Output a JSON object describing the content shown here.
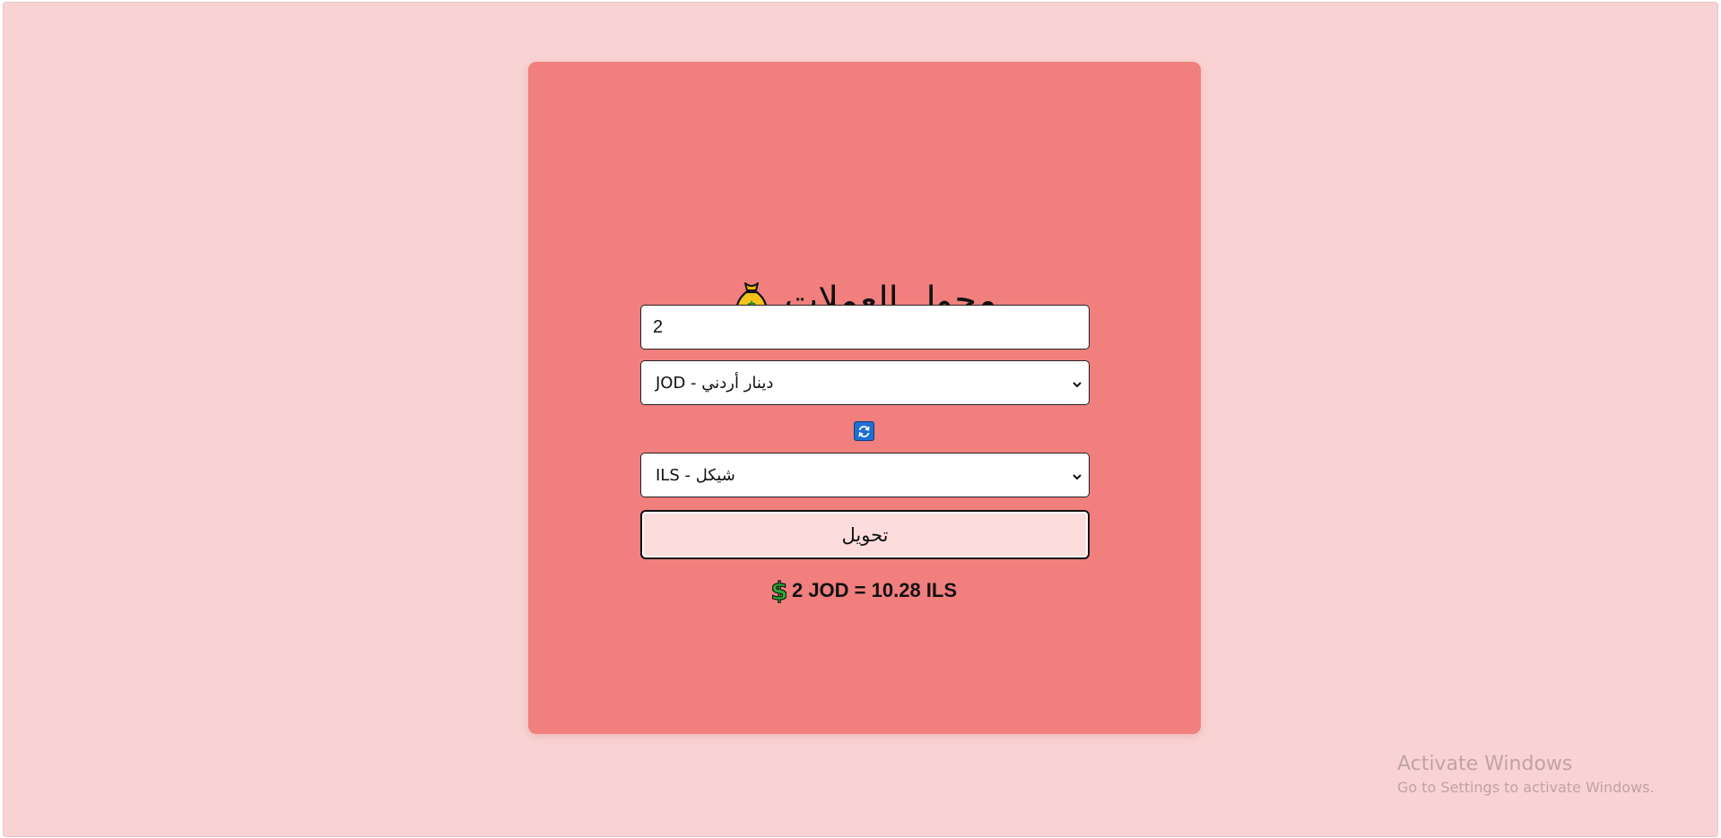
{
  "converter": {
    "title": "محول العملات",
    "title_icon": "money-bag-icon",
    "amount": {
      "value": "2",
      "placeholder": ""
    },
    "from_currency": {
      "selected": "JOD - دينار أردني",
      "code": "JOD"
    },
    "swap_icon": "swap-arrows-icon",
    "to_currency": {
      "selected": "ILS - شيكل",
      "code": "ILS"
    },
    "convert_label": "تحويل",
    "result": {
      "icon": "dollar-icon",
      "text": "2 JOD = 10.28 ILS"
    }
  },
  "watermark": {
    "title": "Activate Windows",
    "subtitle": "Go to Settings to activate Windows."
  },
  "colors": {
    "page_background": "#f9d3d3",
    "card_background": "#f07f7d",
    "button_background": "#fddcdc",
    "swap_icon": "#1f6fd2"
  }
}
